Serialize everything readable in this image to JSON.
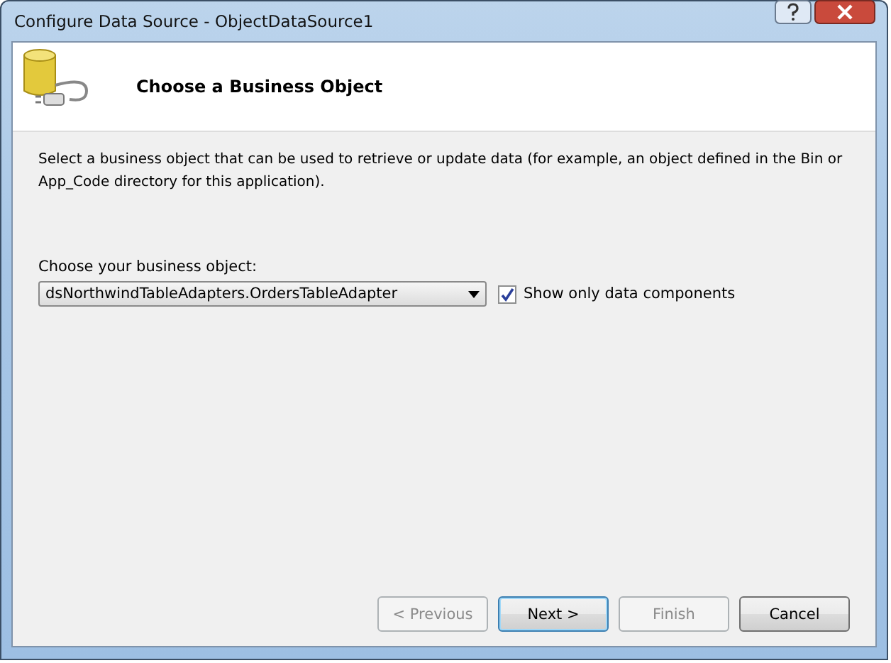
{
  "window": {
    "title": "Configure Data Source - ObjectDataSource1"
  },
  "header": {
    "title": "Choose a Business Object"
  },
  "description": "Select a business object that can be used to retrieve or update data (for example, an object defined in the Bin or App_Code directory for this application).",
  "business_object": {
    "label": "Choose your business object:",
    "value": "dsNorthwindTableAdapters.OrdersTableAdapter"
  },
  "show_only_data_components": {
    "label": "Show only data components",
    "checked": true
  },
  "buttons": [
    {
      "label": "< Previous",
      "disabled": true,
      "default": false
    },
    {
      "label": "Next >",
      "disabled": false,
      "default": true
    },
    {
      "label": "Finish",
      "disabled": true,
      "default": false
    },
    {
      "label": "Cancel",
      "disabled": false,
      "default": false
    }
  ]
}
